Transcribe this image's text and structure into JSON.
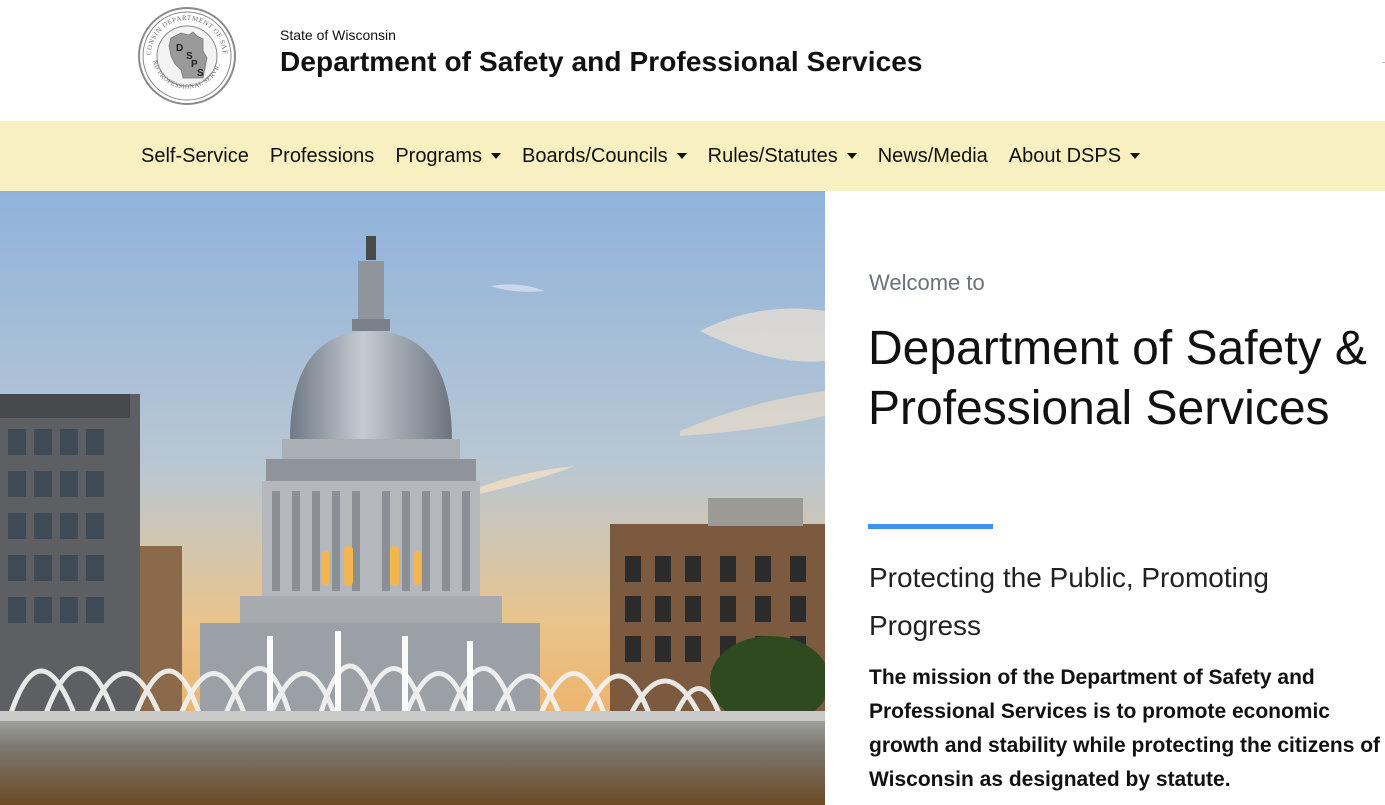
{
  "header": {
    "state_label": "State of Wisconsin",
    "title": "Department of Safety and Professional Services",
    "logo": {
      "icon": "dsps-seal",
      "ring_text_top": "WISCONSIN DEPARTMENT OF SAFETY",
      "ring_text_bottom": "AND PROFESSIONAL SERVICES",
      "letters": [
        "D",
        "S",
        "P",
        "S"
      ]
    }
  },
  "nav": {
    "items": [
      {
        "label": "Self-Service",
        "dropdown": false
      },
      {
        "label": "Professions",
        "dropdown": false
      },
      {
        "label": "Programs",
        "dropdown": true
      },
      {
        "label": "Boards/Councils",
        "dropdown": true
      },
      {
        "label": "Rules/Statutes",
        "dropdown": true
      },
      {
        "label": "News/Media",
        "dropdown": false
      },
      {
        "label": "About DSPS",
        "dropdown": true
      }
    ]
  },
  "hero": {
    "image": "wisconsin-capitol-dome-with-fountain"
  },
  "welcome": {
    "kicker": "Welcome to",
    "title": "Department of Safety & Professional Services",
    "tagline": "Protecting the Public, Promoting Progress",
    "mission": "The mission of the Department of Safety and Professional Services is to promote economic growth and stability while protecting the citizens of Wisconsin as designated by statute."
  },
  "colors": {
    "nav_background": "#f8f0c0",
    "accent": "#3e92ef",
    "muted_text": "#6b727a"
  }
}
